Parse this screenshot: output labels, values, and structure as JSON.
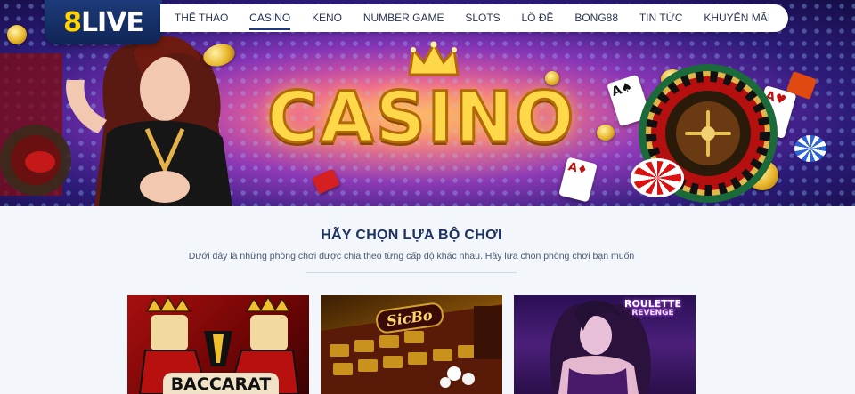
{
  "logo": {
    "number": "8",
    "text": "LIVE"
  },
  "nav": {
    "items": [
      {
        "label": "THỂ THAO",
        "active": false
      },
      {
        "label": "CASINO",
        "active": true
      },
      {
        "label": "KENO",
        "active": false
      },
      {
        "label": "NUMBER GAME",
        "active": false
      },
      {
        "label": "SLOTS",
        "active": false
      },
      {
        "label": "LÔ ĐỀ",
        "active": false
      },
      {
        "label": "BONG88",
        "active": false
      },
      {
        "label": "TIN TỨC",
        "active": false
      },
      {
        "label": "KHUYẾN MÃI",
        "active": false
      }
    ]
  },
  "hero": {
    "title": "CASINO"
  },
  "section": {
    "title": "HÃY CHỌN LỰA BỘ CHƠI",
    "subtitle": "Dưới đây là những phòng chơi được chia theo từng cấp độ khác nhau. Hãy lựa chọn phòng chơi bạn muốn"
  },
  "games": [
    {
      "label": "BACCARAT"
    },
    {
      "label": "SicBo"
    },
    {
      "label_line1": "ROULETTE",
      "label_line2": "REVENGE"
    }
  ],
  "colors": {
    "brand_navy": "#1d3b7a",
    "logo_accent": "#ffd400",
    "title_text": "#1d3160",
    "casino_gold": "#ffd84a"
  }
}
